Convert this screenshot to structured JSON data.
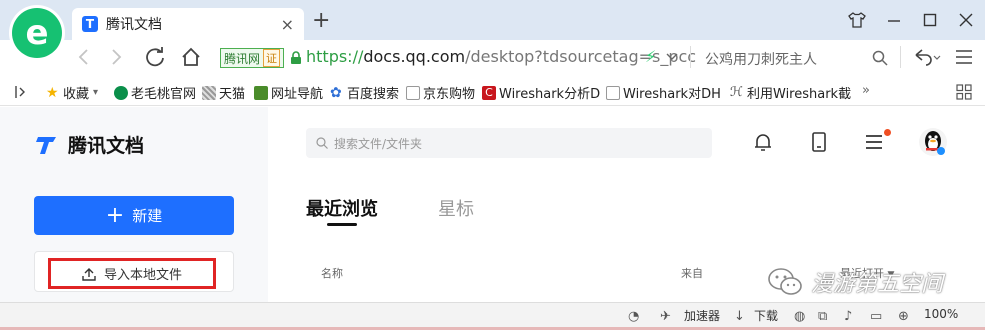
{
  "browser": {
    "tab_title": "腾讯文档",
    "tab_close": "×",
    "new_tab": "+",
    "address": {
      "https": "https://",
      "host": "docs.qq.com",
      "path": "/desktop?tdsourcetag=s_pcc"
    },
    "site_badge": "腾讯网",
    "site_badge_tag": "证",
    "search_hint": "公鸡用刀刺死主人",
    "bookmarks": [
      {
        "label": "收藏",
        "icon": "star-icon"
      },
      {
        "label": "老毛桃官网",
        "icon": "globe-icon"
      },
      {
        "label": "天猫",
        "icon": "tmall-icon"
      },
      {
        "label": "网址导航",
        "icon": "home-icon"
      },
      {
        "label": "百度搜索",
        "icon": "baidu-icon"
      },
      {
        "label": "京东购物",
        "icon": "page-icon"
      },
      {
        "label": "Wireshark分析D",
        "icon": "csdn-icon"
      },
      {
        "label": "Wireshark对DH",
        "icon": "page-icon"
      },
      {
        "label": "利用Wireshark截",
        "icon": "link-icon"
      }
    ],
    "bookmarks_more": "»"
  },
  "app": {
    "brand": "腾讯文档",
    "new_button": "新建",
    "new_plus": "+",
    "import_button": "导入本地文件",
    "search_placeholder": "搜索文件/文件夹",
    "tabs": {
      "recent": "最近浏览",
      "starred": "星标"
    },
    "columns": {
      "name": "名称",
      "source": "来自",
      "last_opened": "最近打开"
    }
  },
  "watermark": "漫游第五空间",
  "statusbar": {
    "accelerator": "加速器",
    "download": "下载",
    "zoom": "100%"
  },
  "colors": {
    "accent": "#1e6fff",
    "highlight_box": "#e02424",
    "logo_green": "#16c172"
  }
}
